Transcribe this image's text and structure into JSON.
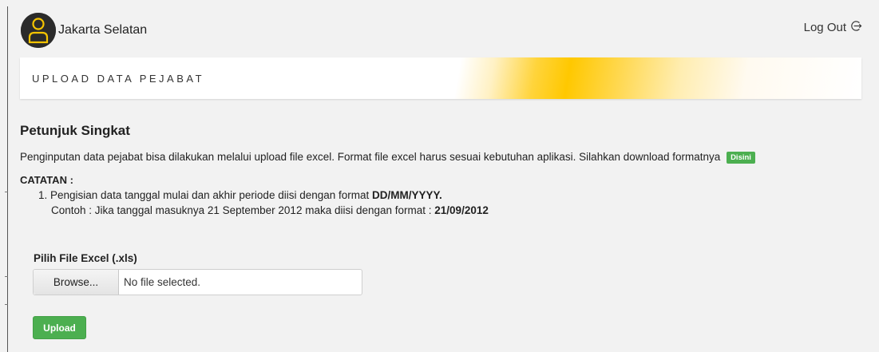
{
  "header": {
    "user_name": "Jakarta Selatan",
    "logout_label": "Log Out"
  },
  "banner": {
    "title": "UPLOAD DATA PEJABAT"
  },
  "instructions": {
    "heading": "Petunjuk Singkat",
    "description": "Penginputan data pejabat bisa dilakukan melalui upload file excel. Format file excel harus sesuai kebutuhan aplikasi. Silahkan download formatnya",
    "download_link_label": "Disini",
    "note_heading": "CATATAN :",
    "note_item_prefix": "1. Pengisian data tanggal mulai dan akhir periode diisi dengan format ",
    "note_item_format": "DD/MM/YYYY.",
    "example_prefix": "Contoh : Jika tanggal masuknya 21 September 2012 maka diisi dengan format : ",
    "example_value": "21/09/2012"
  },
  "upload_form": {
    "file_label": "Pilih File Excel (.xls)",
    "browse_label": "Browse...",
    "file_status": "No file selected.",
    "submit_label": "Upload"
  },
  "colors": {
    "accent_yellow": "#ffc800",
    "button_green": "#4caf50",
    "background": "#f2f2f2"
  },
  "icons": {
    "avatar": "user-avatar-icon",
    "logout": "logout-icon"
  }
}
